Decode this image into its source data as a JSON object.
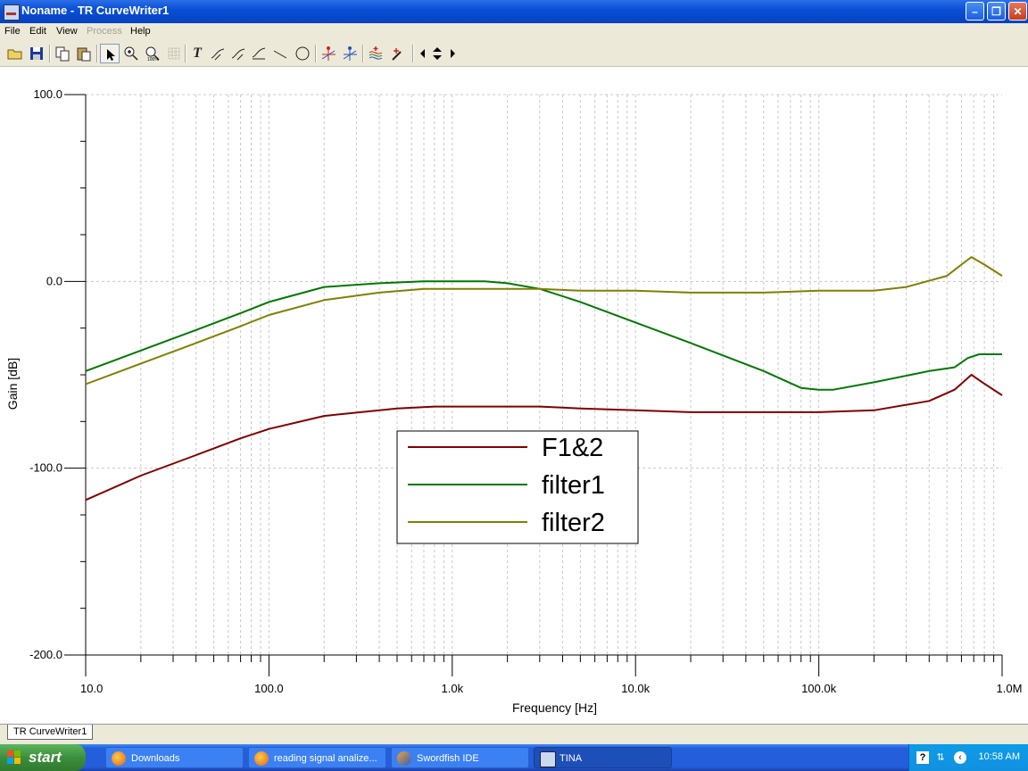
{
  "window": {
    "title": "Noname - TR CurveWriter1",
    "controls": [
      "minimize-icon",
      "restore-icon",
      "close-icon"
    ]
  },
  "menu": {
    "items": [
      {
        "label": "File",
        "enabled": true
      },
      {
        "label": "Edit",
        "enabled": true
      },
      {
        "label": "View",
        "enabled": true
      },
      {
        "label": "Process",
        "enabled": false
      },
      {
        "label": "Help",
        "enabled": true
      }
    ]
  },
  "toolbar": {
    "icons": [
      "open-icon",
      "save-icon",
      "copy-icon",
      "paste-icon",
      "pointer-icon",
      "zoom-in-icon",
      "zoom-100-icon",
      "grid-icon",
      "text-icon",
      "curve-label-icon",
      "curve-label-2-icon",
      "axis-label-icon",
      "line-icon",
      "circle-icon",
      "cursor-a-icon",
      "cursor-b-icon",
      "curves-icon",
      "marker-icon",
      "nav-left-icon",
      "nav-updown-icon",
      "nav-right-icon"
    ]
  },
  "chart_data": {
    "type": "line",
    "xlabel": "Frequency [Hz]",
    "ylabel": "Gain [dB]",
    "x_scale": "log",
    "xlim": [
      10,
      1000000
    ],
    "ylim": [
      -200,
      100
    ],
    "xticks": [
      10,
      100,
      1000,
      10000,
      100000,
      1000000
    ],
    "xtick_labels": [
      "10.0",
      "100.0",
      "1.0k",
      "10.0k",
      "100.0k",
      "1.0M"
    ],
    "yticks": [
      100,
      0,
      -100,
      -200
    ],
    "ytick_labels": [
      "100.0",
      "0.0",
      "-100.0",
      "-200.0"
    ],
    "grid": true,
    "legend_position": "center-left",
    "series": [
      {
        "name": "F1&2",
        "color": "#800000",
        "points": [
          [
            10,
            -117
          ],
          [
            20,
            -104
          ],
          [
            40,
            -93
          ],
          [
            70,
            -84
          ],
          [
            100,
            -79
          ],
          [
            200,
            -72
          ],
          [
            500,
            -68
          ],
          [
            800,
            -67
          ],
          [
            1000,
            -67
          ],
          [
            2000,
            -67
          ],
          [
            3000,
            -67
          ],
          [
            5000,
            -68
          ],
          [
            10000,
            -69
          ],
          [
            20000,
            -70
          ],
          [
            50000,
            -70
          ],
          [
            100000,
            -70
          ],
          [
            200000,
            -69
          ],
          [
            400000,
            -64
          ],
          [
            550000,
            -58
          ],
          [
            680000,
            -50
          ],
          [
            780000,
            -54
          ],
          [
            1000000,
            -61
          ]
        ]
      },
      {
        "name": "filter1",
        "color": "#007800",
        "points": [
          [
            10,
            -48
          ],
          [
            20,
            -37
          ],
          [
            40,
            -26
          ],
          [
            70,
            -17
          ],
          [
            100,
            -11
          ],
          [
            200,
            -3
          ],
          [
            400,
            -1
          ],
          [
            700,
            0
          ],
          [
            1000,
            0
          ],
          [
            1500,
            0
          ],
          [
            2000,
            -1
          ],
          [
            3000,
            -4
          ],
          [
            5000,
            -11
          ],
          [
            10000,
            -22
          ],
          [
            20000,
            -33
          ],
          [
            50000,
            -48
          ],
          [
            80000,
            -57
          ],
          [
            100000,
            -58
          ],
          [
            120000,
            -58
          ],
          [
            200000,
            -54
          ],
          [
            400000,
            -48
          ],
          [
            550000,
            -46
          ],
          [
            650000,
            -41
          ],
          [
            750000,
            -39
          ],
          [
            1000000,
            -39
          ]
        ]
      },
      {
        "name": "filter2",
        "color": "#808000",
        "points": [
          [
            10,
            -55
          ],
          [
            20,
            -44
          ],
          [
            40,
            -33
          ],
          [
            70,
            -24
          ],
          [
            100,
            -18
          ],
          [
            200,
            -10
          ],
          [
            400,
            -6
          ],
          [
            700,
            -4
          ],
          [
            1000,
            -4
          ],
          [
            2000,
            -4
          ],
          [
            3000,
            -4
          ],
          [
            5000,
            -5
          ],
          [
            10000,
            -5
          ],
          [
            20000,
            -6
          ],
          [
            50000,
            -6
          ],
          [
            100000,
            -5
          ],
          [
            200000,
            -5
          ],
          [
            300000,
            -3
          ],
          [
            500000,
            3
          ],
          [
            600000,
            9
          ],
          [
            680000,
            13
          ],
          [
            800000,
            9
          ],
          [
            1000000,
            3
          ]
        ]
      }
    ]
  },
  "tabs": [
    {
      "label": "TR CurveWriter1"
    }
  ],
  "taskbar": {
    "start_label": "start",
    "tasks": [
      {
        "label": "Downloads",
        "icon": "firefox-icon",
        "active": false
      },
      {
        "label": "reading signal analize...",
        "icon": "firefox-icon",
        "active": false
      },
      {
        "label": "Swordfish IDE",
        "icon": "swordfish-icon",
        "active": false
      },
      {
        "label": "TINA",
        "icon": "tina-icon",
        "active": true
      }
    ],
    "clock": "10:58 AM"
  }
}
